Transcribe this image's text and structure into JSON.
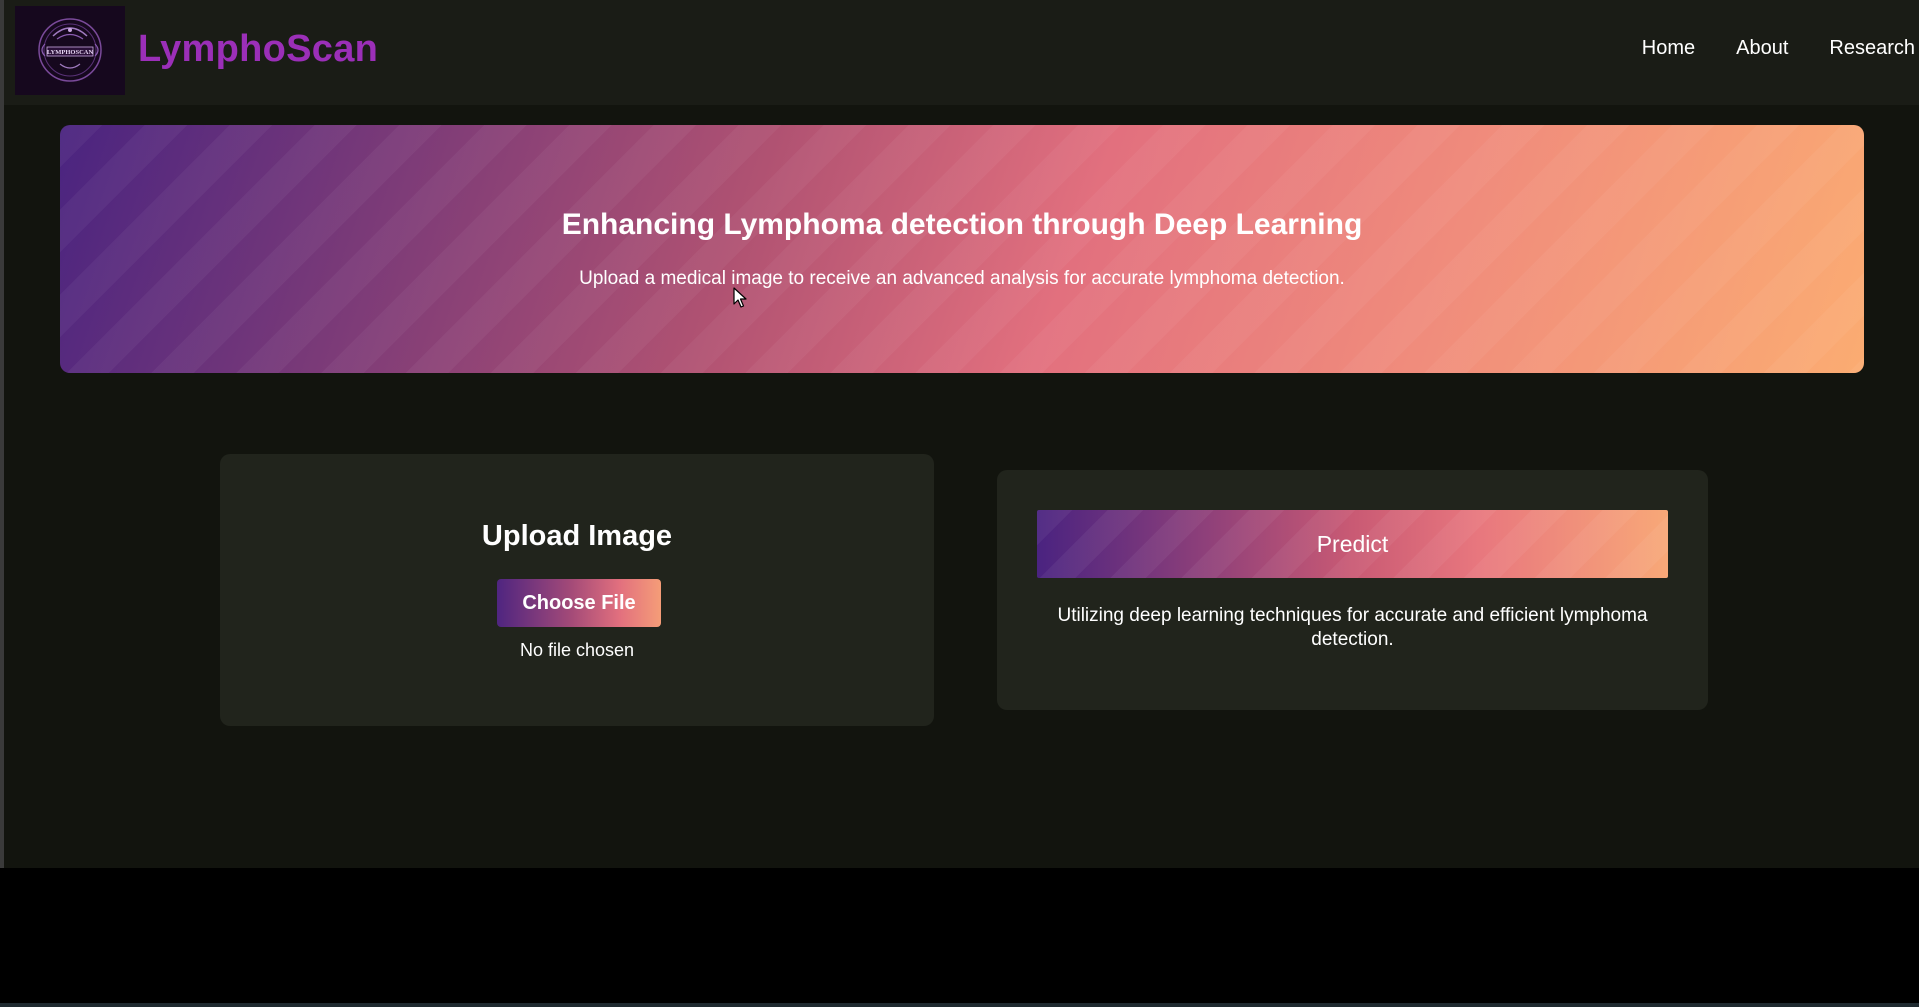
{
  "navbar": {
    "logo_text": "LYMPHOSCAN",
    "brand": "LymphoScan",
    "links": [
      "Home",
      "About",
      "Research"
    ]
  },
  "hero": {
    "title": "Enhancing Lymphoma detection through Deep Learning",
    "subtitle": "Upload a medical image to receive an advanced analysis for accurate lymphoma detection."
  },
  "upload": {
    "title": "Upload Image",
    "button_label": "Choose File",
    "status": "No file chosen"
  },
  "predict": {
    "button_label": "Predict",
    "description": "Utilizing deep learning techniques for accurate and efficient lymphoma detection."
  },
  "colors": {
    "brand": "#9b2fb8",
    "background": "#12140e",
    "card": "#21241c",
    "gradient_start": "#4a2480",
    "gradient_end": "#fbac72"
  }
}
